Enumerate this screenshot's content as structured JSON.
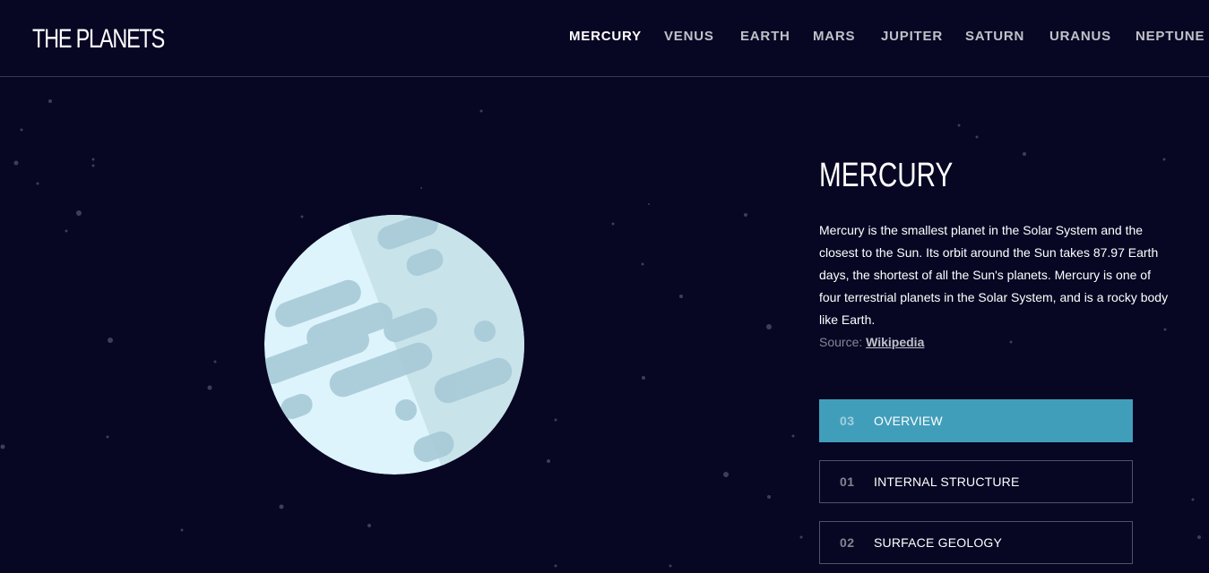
{
  "header": {
    "logo": "THE PLANETS",
    "nav": [
      {
        "label": "MERCURY",
        "active": true
      },
      {
        "label": "VENUS",
        "active": false
      },
      {
        "label": "EARTH",
        "active": false
      },
      {
        "label": "MARS",
        "active": false
      },
      {
        "label": "JUPITER",
        "active": false
      },
      {
        "label": "SATURN",
        "active": false
      },
      {
        "label": "URANUS",
        "active": false
      },
      {
        "label": "NEPTUNE",
        "active": false
      }
    ]
  },
  "planet": {
    "name": "MERCURY",
    "description": "Mercury is the smallest planet in the Solar System and the closest to the Sun. Its orbit around the Sun takes 87.97 Earth days, the shortest of all the Sun's planets. Mercury is one of four terrestrial planets in the Solar System, and is a rocky body like Earth.",
    "source_label": "Source:",
    "source_link": "Wikipedia",
    "image_icon": "mercury-planet-illustration"
  },
  "tabs": [
    {
      "number": "03",
      "label": "OVERVIEW",
      "active": true
    },
    {
      "number": "01",
      "label": "INTERNAL STRUCTURE",
      "active": false
    },
    {
      "number": "02",
      "label": "SURFACE GEOLOGY",
      "active": false
    }
  ],
  "colors": {
    "background": "#070724",
    "accent": "#419ebb",
    "divider": "#38384f",
    "planet_light": "#def4fc",
    "planet_mid": "#c9e3ea",
    "planet_crater": "#a7cad8"
  }
}
